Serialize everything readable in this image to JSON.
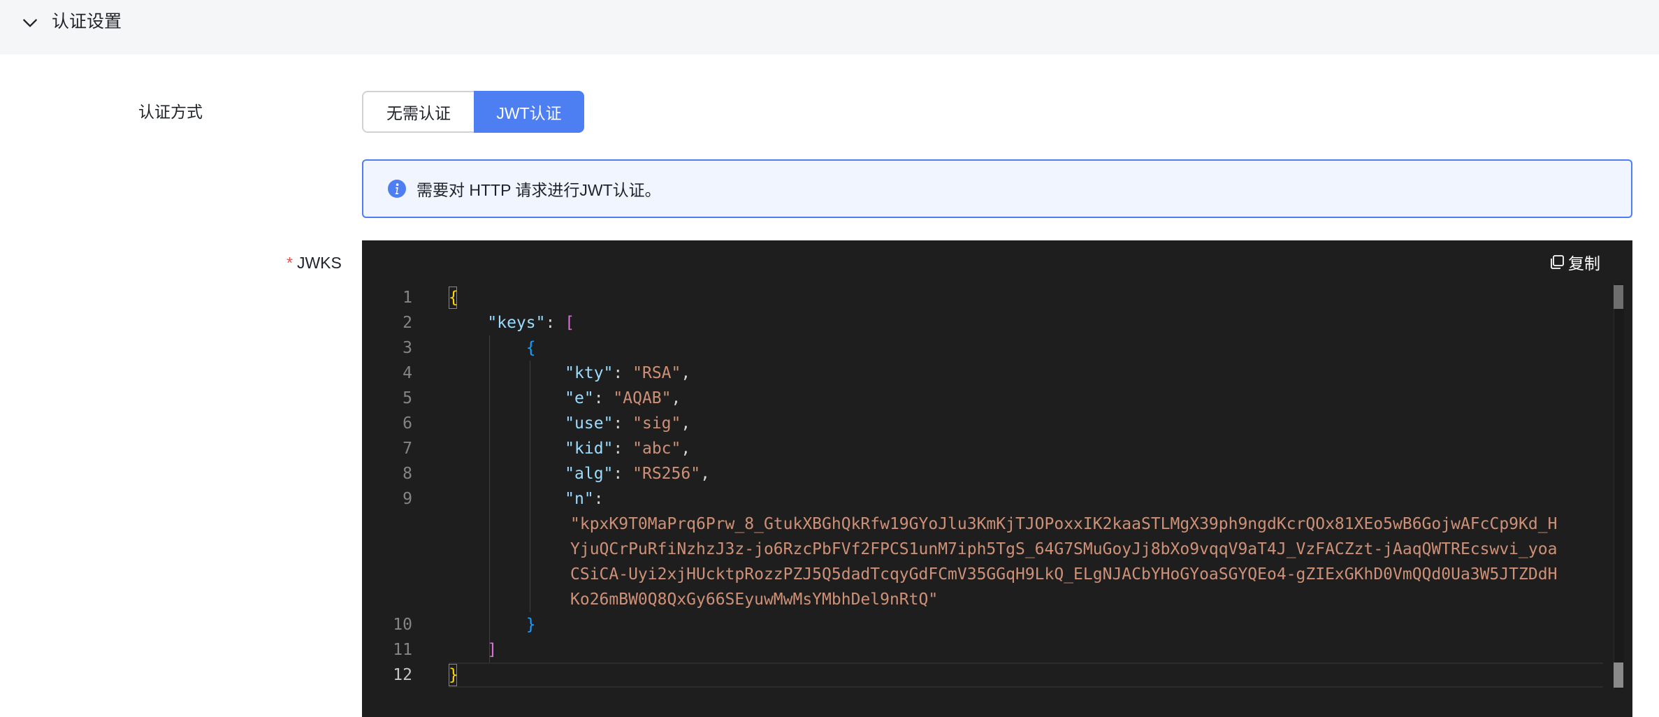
{
  "section": {
    "title": "认证设置"
  },
  "form": {
    "auth_method_label": "认证方式",
    "auth_options": [
      "无需认证",
      "JWT认证"
    ],
    "selected_option": "JWT认证",
    "alert_text": "需要对 HTTP 请求进行JWT认证。",
    "jwks_required_mark": "*",
    "jwks_label": "JWKS"
  },
  "editor": {
    "copy_label": "复制",
    "line_numbers": [
      "1",
      "2",
      "3",
      "4",
      "5",
      "6",
      "7",
      "8",
      "9",
      "10",
      "11",
      "12"
    ],
    "active_line": "12",
    "brace_open": "{",
    "brace_close": "}",
    "keys_key": "\"keys\"",
    "bracket_open": "[",
    "bracket_close": "]",
    "inner_brace_open": "{",
    "inner_brace_close": "}",
    "fields": [
      {
        "key": "\"kty\"",
        "value": "\"RSA\""
      },
      {
        "key": "\"e\"",
        "value": "\"AQAB\""
      },
      {
        "key": "\"use\"",
        "value": "\"sig\""
      },
      {
        "key": "\"kid\"",
        "value": "\"abc\""
      },
      {
        "key": "\"alg\"",
        "value": "\"RS256\""
      }
    ],
    "n_key": "\"n\"",
    "n_value_lines": [
      "\"kpxK9T0MaPrq6Prw_8_GtukXBGhQkRfw19GYoJlu3KmKjTJOPoxxIK2kaaSTLMgX39ph9ngdKcrQOx81XEo5wB6GojwAFcCp9Kd_H",
      "YjuQCrPuRfiNzhzJ3z-jo6RzcPbFVf2FPCS1unM7iph5TgS_64G7SMuGoyJj8bXo9vqqV9aT4J_VzFACZzt-jAaqQWTREcswvi_yoa",
      "CSiCA-Uyi2xjHUcktpRozzPZJ5Q5dadTcqyGdFCmV35GGqH9LkQ_ELgNJACbYHoGYoaSGYQEo4-gZIExGKhD0VmQQd0Ua3W5JTZDdH",
      "Ko26mBW0Q8QxGy66SEyuwMwMsYMbhDel9nRtQ\""
    ]
  },
  "colors": {
    "accent": "#4e7ff2",
    "editor_bg": "#1e1e1e",
    "json_key": "#9cdcfe",
    "json_string": "#ce9178",
    "required": "#f54a45"
  }
}
